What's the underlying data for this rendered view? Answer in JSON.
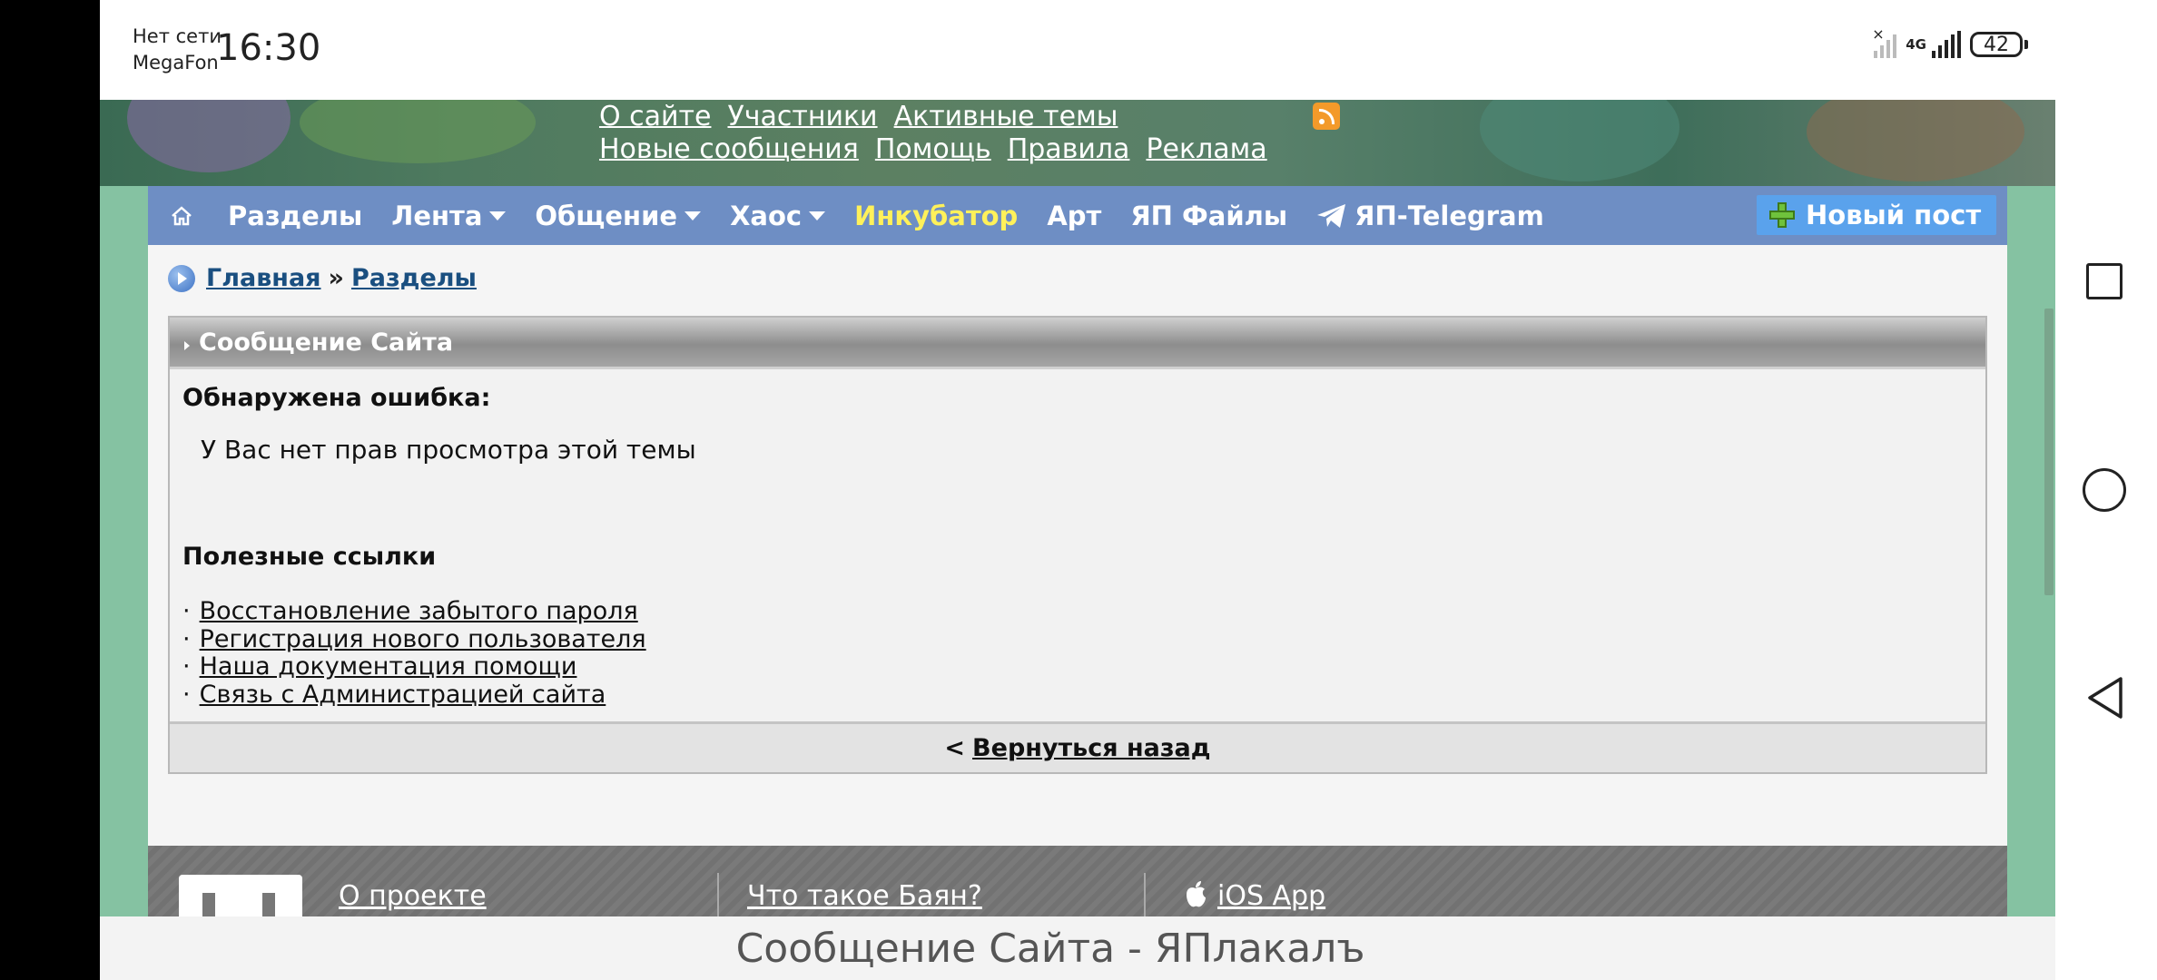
{
  "status_bar": {
    "carrier_line1": "Нет сети",
    "carrier_line2": "MegaFon",
    "time": "16:30",
    "network_type": "4G",
    "battery": "42"
  },
  "header": {
    "links_row1": [
      "О сайте",
      "Участники",
      "Активные темы"
    ],
    "links_row2": [
      "Новые сообщения",
      "Помощь",
      "Правила",
      "Реклама"
    ]
  },
  "nav": {
    "items": [
      "Разделы",
      "Лента",
      "Общение",
      "Хаос",
      "Инкубатор",
      "Арт",
      "ЯП Файлы",
      "ЯП-Telegram"
    ],
    "new_post": "Новый пост"
  },
  "breadcrumb": {
    "home": "Главная",
    "separator": "»",
    "current": "Разделы"
  },
  "message": {
    "header": "Сообщение Сайта",
    "error_title": "Обнаружена ошибка:",
    "error_text": "У Вас нет прав просмотра этой темы",
    "useful_title": "Полезные ссылки",
    "links": [
      "Восстановление забытого пароля",
      "Регистрация нового пользователя",
      "Наша документация помощи",
      "Связь с Администрацией сайта"
    ],
    "back_prefix": "<",
    "back_label": "Вернуться назад"
  },
  "footer": {
    "links": [
      "О проекте",
      "Что такое Баян?",
      "iOS App"
    ]
  },
  "page_title": "Сообщение Сайта - ЯПлакалъ",
  "colors": {
    "nav_bg": "#6e8ec4",
    "accent_yellow": "#fff15a",
    "new_post_bg": "#5aa2ec",
    "page_bg": "#85c2a2"
  }
}
